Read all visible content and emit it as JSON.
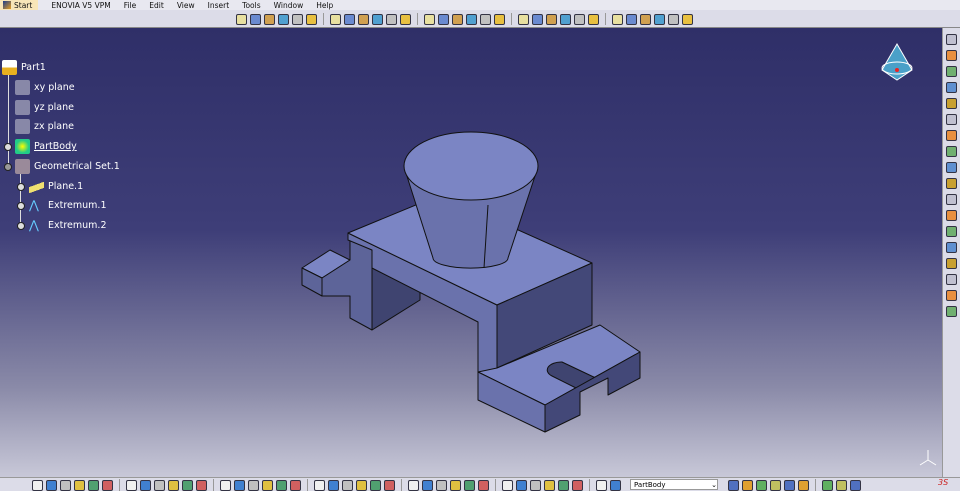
{
  "menu": {
    "start": "Start",
    "items": [
      "ENOVIA V5 VPM",
      "File",
      "Edit",
      "View",
      "Insert",
      "Tools",
      "Window",
      "Help"
    ]
  },
  "tree": {
    "root": "Part1",
    "items": [
      {
        "label": "xy plane",
        "icon": "plane-icon"
      },
      {
        "label": "yz plane",
        "icon": "plane-icon"
      },
      {
        "label": "zx plane",
        "icon": "plane-icon"
      },
      {
        "label": "PartBody",
        "icon": "body-icon"
      },
      {
        "label": "Geometrical Set.1",
        "icon": "geometrical-set-icon"
      },
      {
        "label": "Plane.1",
        "icon": "plane-feature-icon"
      },
      {
        "label": "Extremum.1",
        "icon": "extremum-icon"
      },
      {
        "label": "Extremum.2",
        "icon": "extremum-icon"
      }
    ]
  },
  "bottom": {
    "current_body": "PartBody"
  },
  "colors": {
    "accent": "#f0c020",
    "face_top": "#7b85c4",
    "face_side": "#5d6499",
    "face_dark": "#3f4470"
  }
}
